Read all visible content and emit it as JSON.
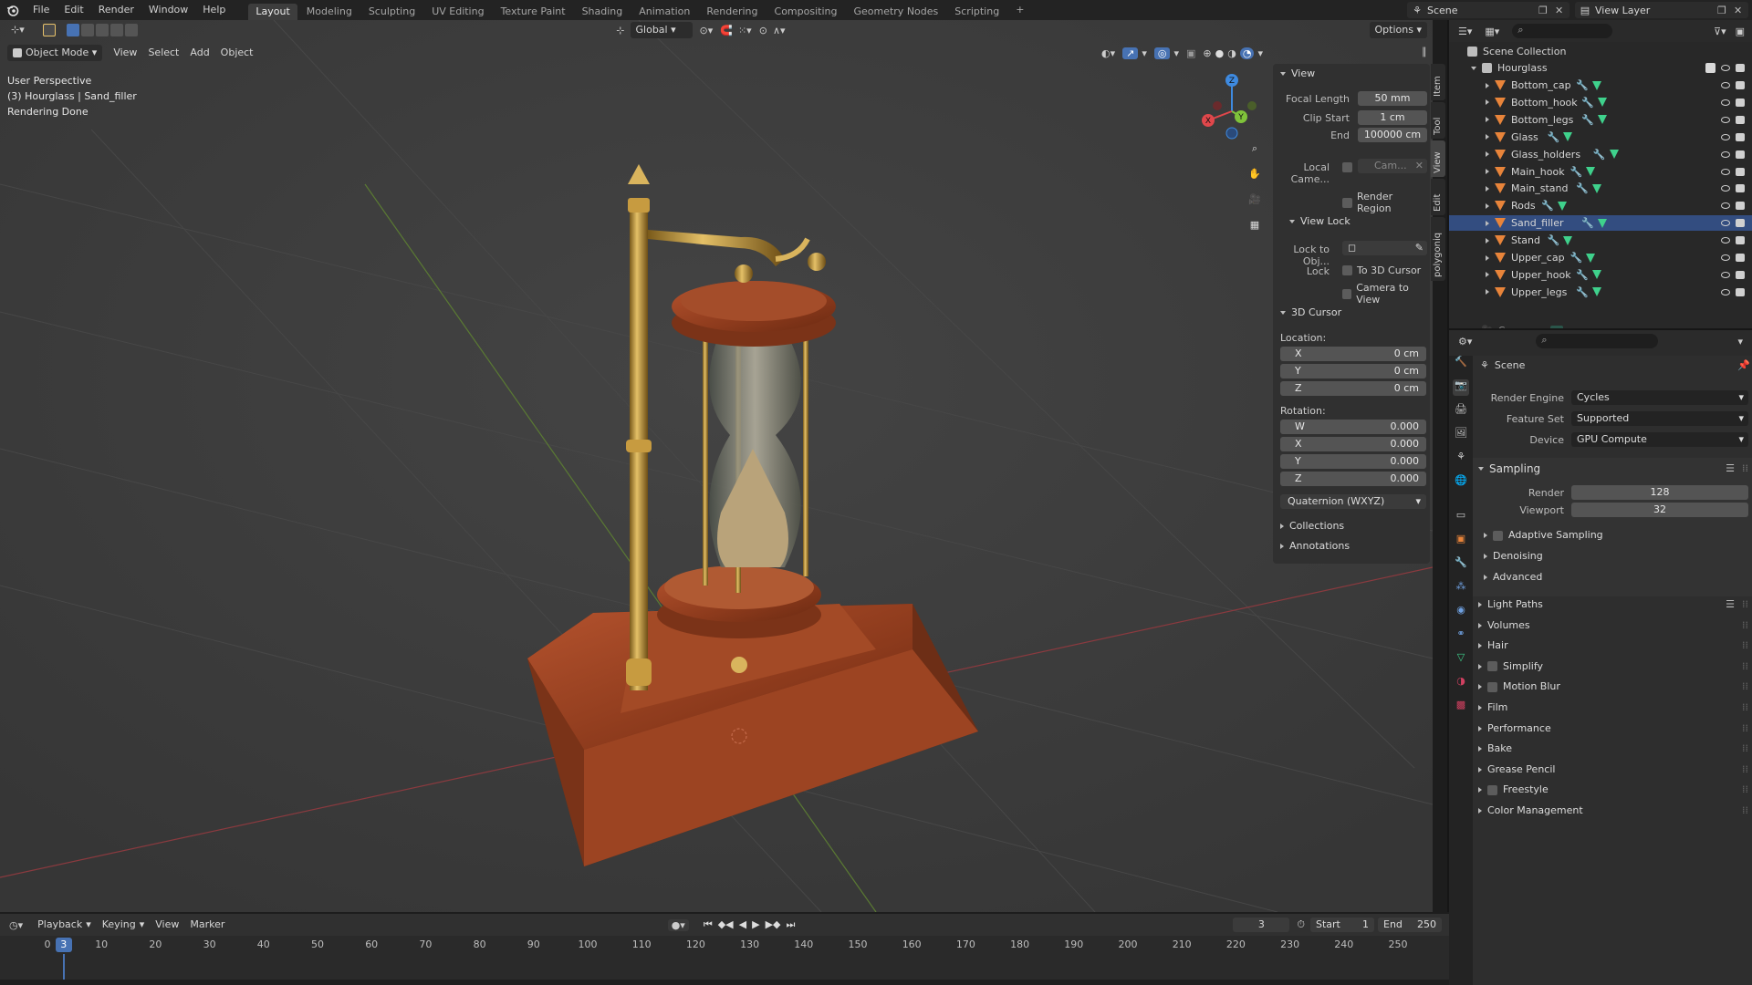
{
  "topbar": {
    "menus": [
      "File",
      "Edit",
      "Render",
      "Window",
      "Help"
    ],
    "workspaces": [
      "Layout",
      "Modeling",
      "Sculpting",
      "UV Editing",
      "Texture Paint",
      "Shading",
      "Animation",
      "Rendering",
      "Compositing",
      "Geometry Nodes",
      "Scripting"
    ],
    "active_workspace": "Layout",
    "add_tab": "+",
    "scene_name": "Scene",
    "view_layer": "View Layer"
  },
  "viewport": {
    "mode": "Object Mode",
    "menus": [
      "View",
      "Select",
      "Add",
      "Object"
    ],
    "transform_orientation": "Global",
    "options_label": "Options",
    "overlay_lines": [
      "User Perspective",
      "(3) Hourglass | Sand_filler",
      "Rendering Done"
    ],
    "gizmo": {
      "x": "X",
      "y": "Y",
      "z": "Z"
    }
  },
  "npanel": {
    "tabs": [
      "Item",
      "Tool",
      "View",
      "Edit",
      "polygoniq"
    ],
    "active_tab": "View",
    "view": {
      "title": "View",
      "focal_length_label": "Focal Length",
      "focal_length": "50 mm",
      "clip_start_label": "Clip Start",
      "clip_start": "1 cm",
      "end_label": "End",
      "end": "100000 cm",
      "local_camera_label": "Local Came...",
      "local_camera_value": "Cam...",
      "render_region": "Render Region"
    },
    "view_lock": {
      "title": "View Lock",
      "lock_to_obj_label": "Lock to Obj...",
      "lock_label": "Lock",
      "to_3d_cursor": "To 3D Cursor",
      "camera_to_view": "Camera to View"
    },
    "cursor": {
      "title": "3D Cursor",
      "location_label": "Location:",
      "location": [
        {
          "axis": "X",
          "value": "0 cm"
        },
        {
          "axis": "Y",
          "value": "0 cm"
        },
        {
          "axis": "Z",
          "value": "0 cm"
        }
      ],
      "rotation_label": "Rotation:",
      "rotation": [
        {
          "axis": "W",
          "value": "0.000"
        },
        {
          "axis": "X",
          "value": "0.000"
        },
        {
          "axis": "Y",
          "value": "0.000"
        },
        {
          "axis": "Z",
          "value": "0.000"
        }
      ],
      "rotation_mode": "Quaternion (WXYZ)"
    },
    "collections": "Collections",
    "annotations": "Annotations"
  },
  "outliner": {
    "scene_collection": "Scene Collection",
    "hourglass": "Hourglass",
    "objects": [
      "Bottom_cap",
      "Bottom_hook",
      "Bottom_legs",
      "Glass",
      "Glass_holders",
      "Main_hook",
      "Main_stand",
      "Rods",
      "Sand_filler",
      "Stand",
      "Upper_cap",
      "Upper_hook",
      "Upper_legs"
    ],
    "camera": "Camera"
  },
  "properties": {
    "header": "Scene",
    "render_engine_label": "Render Engine",
    "render_engine": "Cycles",
    "feature_set_label": "Feature Set",
    "feature_set": "Supported",
    "device_label": "Device",
    "device": "GPU Compute",
    "sampling": {
      "title": "Sampling",
      "render_label": "Render",
      "render_value": "128",
      "viewport_label": "Viewport",
      "viewport_value": "32",
      "adaptive": "Adaptive Sampling",
      "denoising": "Denoising",
      "advanced": "Advanced"
    },
    "sections": [
      {
        "label": "Light Paths",
        "check": false,
        "list": true
      },
      {
        "label": "Volumes",
        "check": false,
        "list": false
      },
      {
        "label": "Hair",
        "check": false,
        "list": false
      },
      {
        "label": "Simplify",
        "check": true,
        "list": false
      },
      {
        "label": "Motion Blur",
        "check": true,
        "list": false
      },
      {
        "label": "Film",
        "check": false,
        "list": false
      },
      {
        "label": "Performance",
        "check": false,
        "list": false
      },
      {
        "label": "Bake",
        "check": false,
        "list": false
      },
      {
        "label": "Grease Pencil",
        "check": false,
        "list": false
      },
      {
        "label": "Freestyle",
        "check": true,
        "list": false
      },
      {
        "label": "Color Management",
        "check": false,
        "list": false
      }
    ]
  },
  "timeline": {
    "menus": [
      "Playback",
      "Keying",
      "View",
      "Marker"
    ],
    "current_frame": "3",
    "start_label": "Start",
    "start": "1",
    "end_label": "End",
    "end": "250",
    "ruler": [
      "0",
      "10",
      "20",
      "30",
      "40",
      "50",
      "60",
      "70",
      "80",
      "90",
      "100",
      "110",
      "120",
      "130",
      "140",
      "150",
      "160",
      "170",
      "180",
      "190",
      "200",
      "210",
      "220",
      "230",
      "240",
      "250"
    ]
  },
  "colors": {
    "accent": "#4772b3",
    "object_orange": "#e8843a",
    "modifier_blue": "#6fa0e0",
    "mesh_green": "#3fd18c",
    "axis_x": "#e0474b",
    "axis_y": "#7fc33a",
    "axis_z": "#3e8ae0"
  }
}
